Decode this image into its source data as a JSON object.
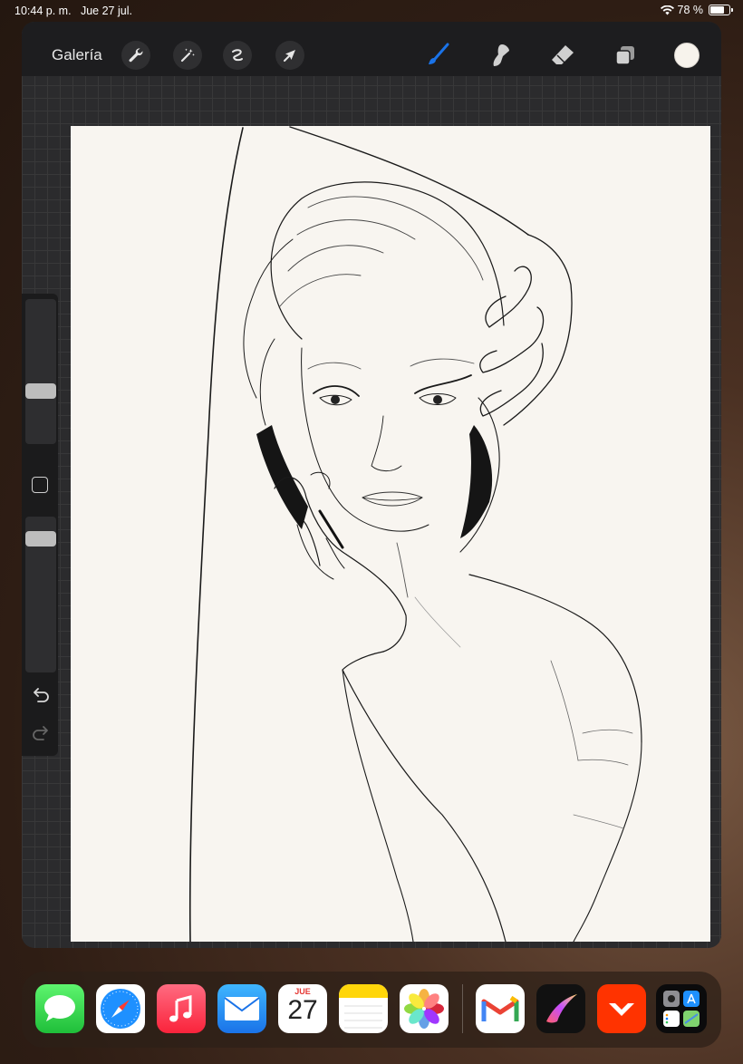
{
  "status_bar": {
    "time_date": "10:44 p. m.   Jue 27 jul.",
    "battery_percent": "78 %",
    "battery_level": 0.78
  },
  "toolbar": {
    "gallery_label": "Galería",
    "left_tools": [
      "wrench-icon",
      "magic-wand-icon",
      "selection-icon",
      "transform-arrow-icon"
    ],
    "right_tools": [
      "brush-icon",
      "smudge-icon",
      "eraser-icon",
      "layers-icon"
    ],
    "active_tool": "brush-icon",
    "accent_color": "#1a73e8",
    "current_color": "#f7f3ec"
  },
  "sidebar": {
    "brush_size_level": 0.35,
    "opacity_level": 0.9
  },
  "dock": {
    "apps": [
      "Messages",
      "Safari",
      "Music",
      "Mail",
      "Calendar",
      "Notes",
      "Photos",
      "Gmail",
      "Procreate",
      "AliExpress",
      "App Library"
    ],
    "calendar_day": "JUE",
    "calendar_date": "27"
  }
}
